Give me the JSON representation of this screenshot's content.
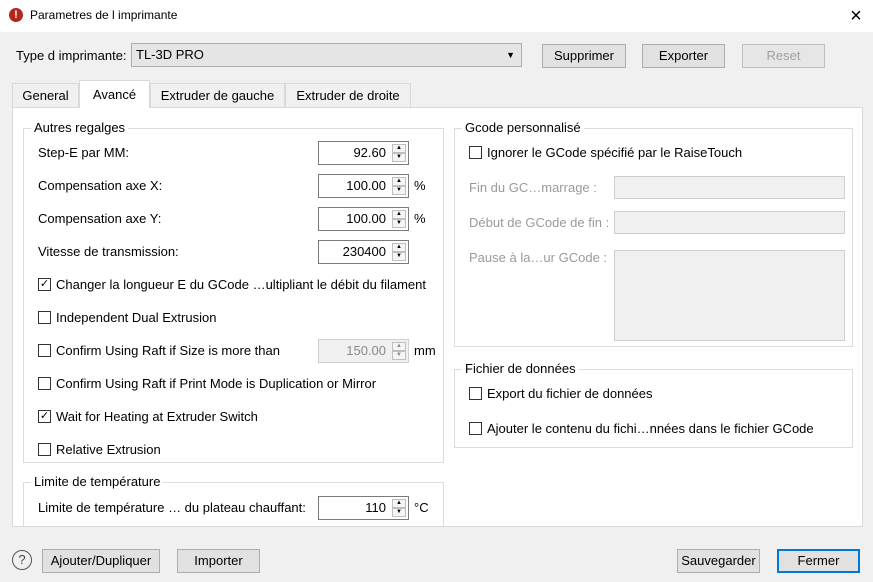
{
  "window": {
    "title": "Parametres de l imprimante"
  },
  "printer_type": {
    "label": "Type d imprimante:",
    "value": "TL-3D PRO"
  },
  "top_buttons": {
    "delete": "Supprimer",
    "export": "Exporter",
    "reset": "Reset"
  },
  "tabs": [
    {
      "label": "General",
      "active": false
    },
    {
      "label": "Avancé",
      "active": true
    },
    {
      "label": "Extruder de gauche",
      "active": false
    },
    {
      "label": "Extruder de droite",
      "active": false
    }
  ],
  "other_settings": {
    "title": "Autres regalges",
    "stepe": {
      "label": "Step-E par MM:",
      "value": "92.60"
    },
    "comp_x": {
      "label": "Compensation axe X:",
      "value": "100.00",
      "unit": "%"
    },
    "comp_y": {
      "label": "Compensation axe Y:",
      "value": "100.00",
      "unit": "%"
    },
    "baud": {
      "label": "Vitesse de transmission:",
      "value": "230400"
    },
    "checkboxes": [
      {
        "label": "Changer la longueur E du GCode …ultipliant le débit du filament",
        "checked": true
      },
      {
        "label": "Independent Dual Extrusion",
        "checked": false
      },
      {
        "label": "Confirm Using Raft if Size is more than",
        "checked": false
      },
      {
        "label": "Confirm Using Raft if Print Mode is Duplication or Mirror",
        "checked": false
      },
      {
        "label": "Wait for Heating at Extruder Switch",
        "checked": true
      },
      {
        "label": "Relative Extrusion",
        "checked": false
      }
    ],
    "raft_size": {
      "value": "150.00",
      "unit": "mm"
    }
  },
  "temp_limit": {
    "title": "Limite de température",
    "bed": {
      "label": "Limite de température … du plateau chauffant:",
      "value": "110",
      "unit": "°C"
    }
  },
  "gcode": {
    "title": "Gcode personnalisé",
    "ignore": {
      "label": "Ignorer le GCode spécifié par le RaiseTouch",
      "checked": false
    },
    "start": {
      "label": "Fin du GC…marrage :"
    },
    "end": {
      "label": "Début de GCode de fin :"
    },
    "pause": {
      "label": "Pause à la…ur GCode :"
    }
  },
  "data_file": {
    "title": "Fichier de données",
    "export": {
      "label": "Export du fichier de données",
      "checked": false
    },
    "append": {
      "label": "Ajouter le contenu du fichi…nnées dans le fichier GCode",
      "checked": false
    }
  },
  "bottom_buttons": {
    "help": "?",
    "add": "Ajouter/Dupliquer",
    "import": "Importer",
    "save": "Sauvegarder",
    "close": "Fermer"
  }
}
